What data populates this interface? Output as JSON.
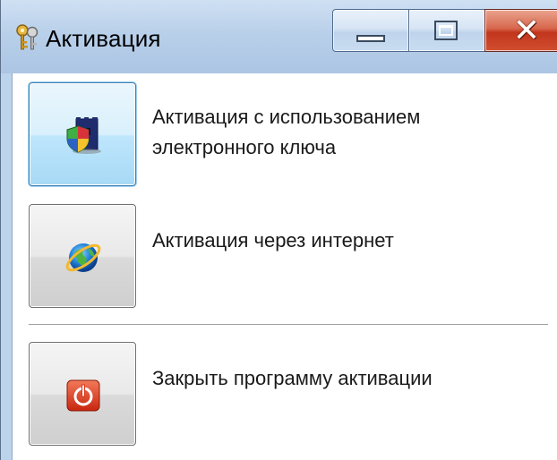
{
  "window": {
    "title": "Активация",
    "app_icon": "keys-icon",
    "controls": {
      "minimize_icon": "minimize-icon",
      "maximize_icon": "maximize-icon",
      "close_icon": "close-icon",
      "close_glyph": "✕"
    }
  },
  "options": [
    {
      "icon": "shield-tower-icon",
      "label_line1": "Активация с использованием",
      "label_line2": "электронного ключа",
      "focused": true
    },
    {
      "icon": "internet-globe-icon",
      "label": "Активация через интернет"
    },
    {
      "icon": "power-icon",
      "label": "Закрыть программу активации"
    }
  ],
  "colors": {
    "close_red": "#c2351d",
    "focus_blue": "#3c7fb1",
    "power_red": "#d8351c"
  }
}
